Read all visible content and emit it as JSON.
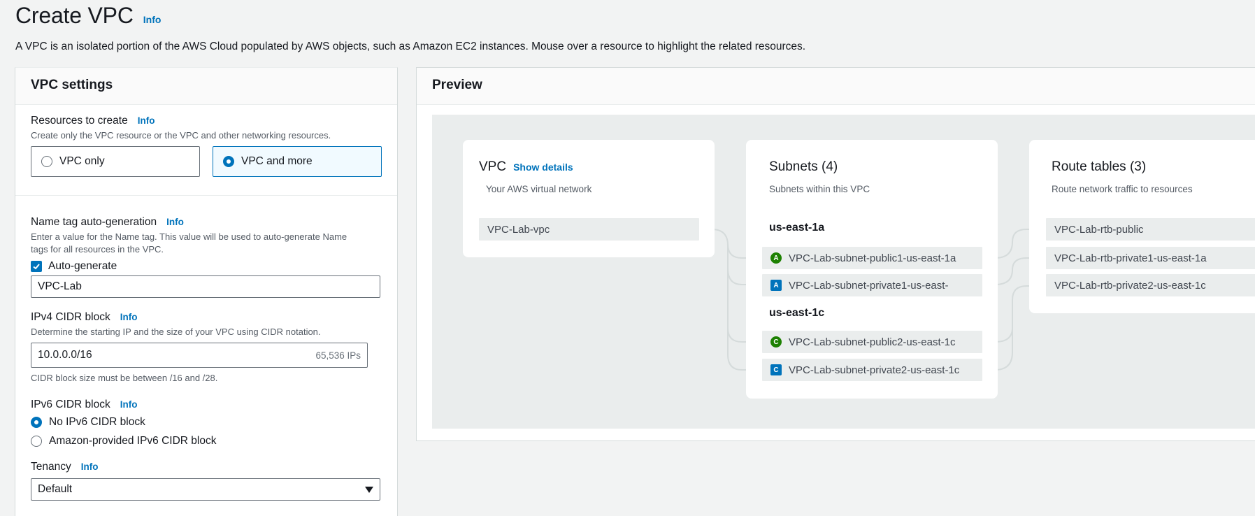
{
  "header": {
    "title": "Create VPC",
    "info": "Info",
    "description": "A VPC is an isolated portion of the AWS Cloud populated by AWS objects, such as Amazon EC2 instances. Mouse over a resource to highlight the related resources."
  },
  "settings": {
    "title": "VPC settings",
    "resources": {
      "label": "Resources to create",
      "info": "Info",
      "hint": "Create only the VPC resource or the VPC and other networking resources.",
      "option_vpc_only": "VPC only",
      "option_vpc_more": "VPC and more",
      "selected": "VPC and more"
    },
    "name_tag": {
      "label": "Name tag auto-generation",
      "info": "Info",
      "hint": "Enter a value for the Name tag. This value will be used to auto-generate Name tags for all resources in the VPC.",
      "checkbox_label": "Auto-generate",
      "checked": true,
      "value": "VPC-Lab"
    },
    "ipv4": {
      "label": "IPv4 CIDR block",
      "info": "Info",
      "hint": "Determine the starting IP and the size of your VPC using CIDR notation.",
      "value": "10.0.0.0/16",
      "suffix": "65,536 IPs",
      "constraint": "CIDR block size must be between /16 and /28."
    },
    "ipv6": {
      "label": "IPv6 CIDR block",
      "info": "Info",
      "option_none": "No IPv6 CIDR block",
      "option_amazon": "Amazon-provided IPv6 CIDR block",
      "selected": "No IPv6 CIDR block"
    },
    "tenancy": {
      "label": "Tenancy",
      "info": "Info",
      "value": "Default"
    }
  },
  "preview": {
    "title": "Preview",
    "vpc": {
      "title": "VPC",
      "link": "Show details",
      "subtitle": "Your AWS virtual network",
      "name": "VPC-Lab-vpc"
    },
    "subnets": {
      "title": "Subnets (4)",
      "subtitle": "Subnets within this VPC",
      "zones": [
        {
          "name": "us-east-1a",
          "items": [
            {
              "badge": "A",
              "type": "public",
              "name": "VPC-Lab-subnet-public1-us-east-1a"
            },
            {
              "badge": "A",
              "type": "private",
              "name": "VPC-Lab-subnet-private1-us-east-"
            }
          ]
        },
        {
          "name": "us-east-1c",
          "items": [
            {
              "badge": "C",
              "type": "public",
              "name": "VPC-Lab-subnet-public2-us-east-1c"
            },
            {
              "badge": "C",
              "type": "private",
              "name": "VPC-Lab-subnet-private2-us-east-1c"
            }
          ]
        }
      ]
    },
    "route_tables": {
      "title": "Route tables (3)",
      "subtitle": "Route network traffic to resources",
      "items": [
        "VPC-Lab-rtb-public",
        "VPC-Lab-rtb-private1-us-east-1a",
        "VPC-Lab-rtb-private2-us-east-1c"
      ]
    }
  },
  "colors": {
    "accent": "#0073bb",
    "public_badge": "#1d8102",
    "private_badge": "#0073bb"
  }
}
